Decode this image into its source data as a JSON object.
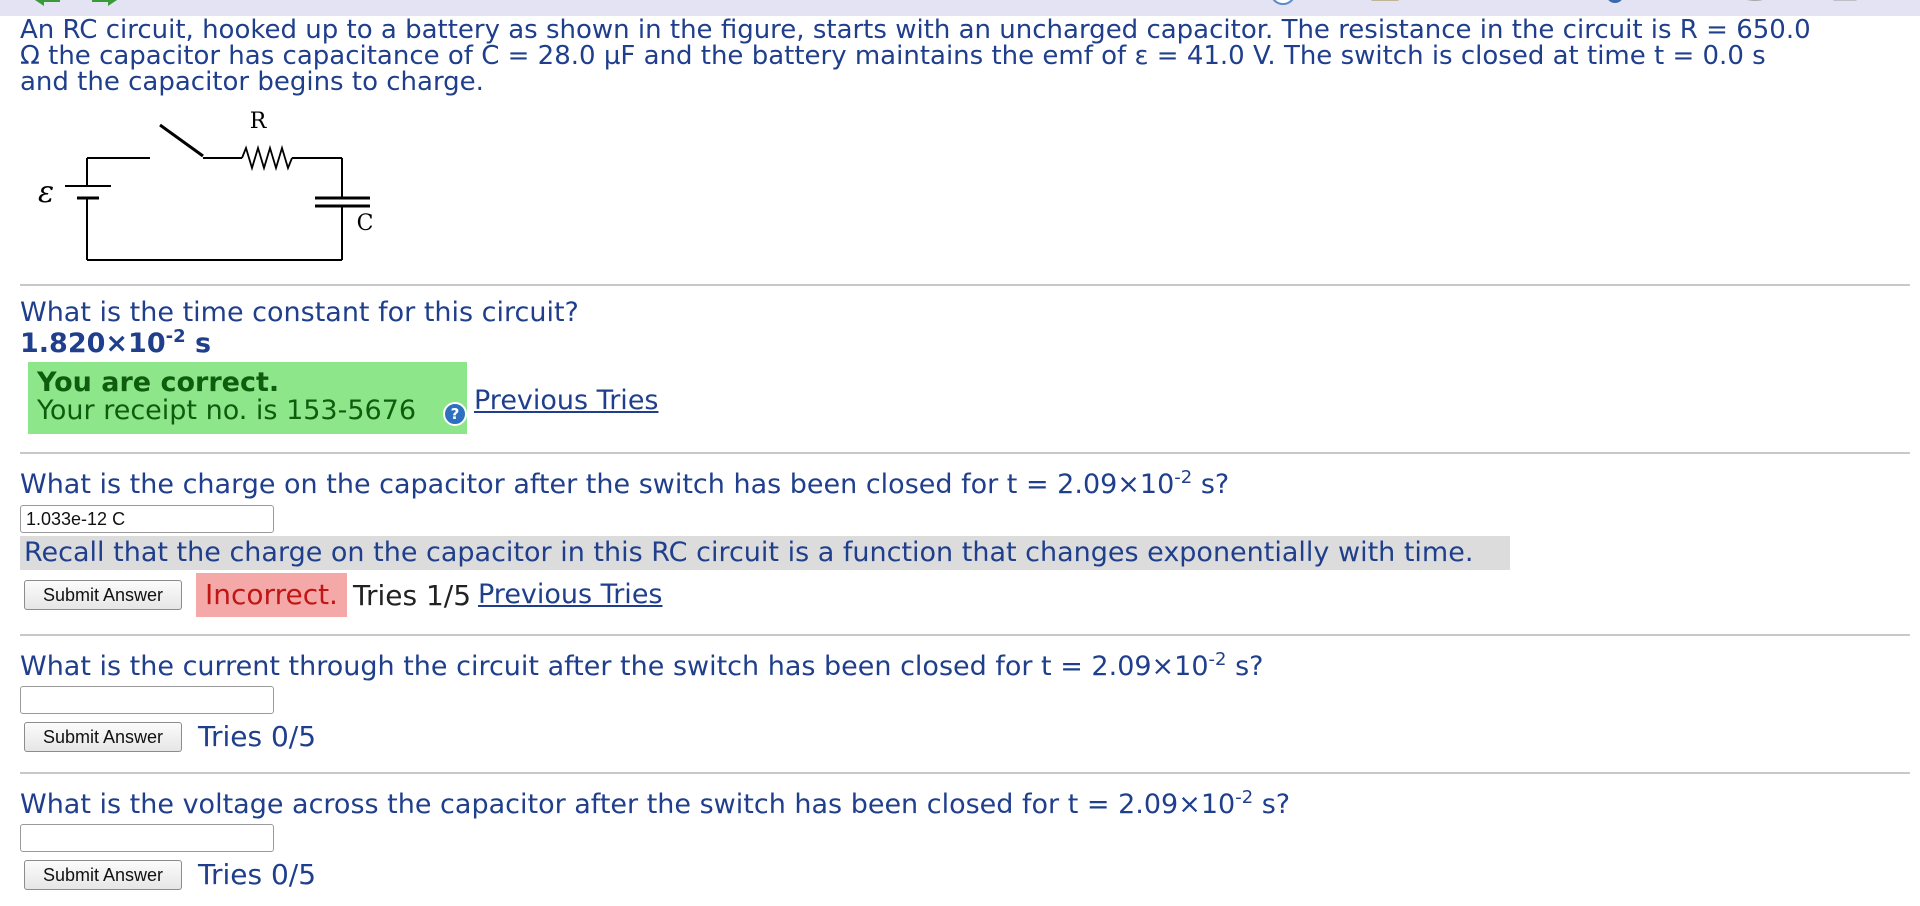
{
  "toolbar": {
    "icons": [
      "back-arrow-icon",
      "forward-arrow-icon",
      "circle-icon",
      "note-icon",
      "leaf-icon",
      "gear-icon",
      "disk-icon",
      "edit-icon"
    ]
  },
  "problem": {
    "line1": "An RC circuit, hooked up to a battery as shown in the figure, starts with an uncharged capacitor. The resistance in the circuit is R = 650.0",
    "line2": "Ω the capacitor has capacitance of C = 28.0 µF and the battery maintains the emf of ε = 41.0 V. The switch is closed at time t = 0.0 s",
    "line3": "and the capacitor begins to charge."
  },
  "figure": {
    "resistor_label": "R",
    "capacitor_label": "C",
    "emf_label": "ε"
  },
  "q1": {
    "question": "What is the time constant for this circuit?",
    "answer_mantissa": "1.820×10",
    "answer_exp": "-2",
    "answer_unit": " s",
    "status_title": "You are correct.",
    "receipt": "Your receipt no. is 153-5676",
    "help_symbol": "?",
    "previous_tries": "Previous Tries"
  },
  "q2": {
    "question_pre": "What is the charge on the capacitor after the switch has been closed for t = 2.09×10",
    "question_exp": "-2",
    "question_post": " s?",
    "input_value": "1.033e-12 C",
    "hint": "Recall that the charge on the capacitor in this RC circuit is a function that changes exponentially with time.",
    "submit": "Submit Answer",
    "status": "Incorrect.",
    "tries": "Tries 1/5",
    "previous_tries": "Previous Tries"
  },
  "q3": {
    "question_pre": "What is the current through the circuit after the switch has been closed for t = 2.09×10",
    "question_exp": "-2",
    "question_post": " s?",
    "input_value": "",
    "submit": "Submit Answer",
    "tries": "Tries 0/5"
  },
  "q4": {
    "question_pre": "What is the voltage across the capacitor after the switch has been closed for t = 2.09×10",
    "question_exp": "-2",
    "question_post": " s?",
    "input_value": "",
    "submit": "Submit Answer",
    "tries": "Tries 0/5"
  }
}
